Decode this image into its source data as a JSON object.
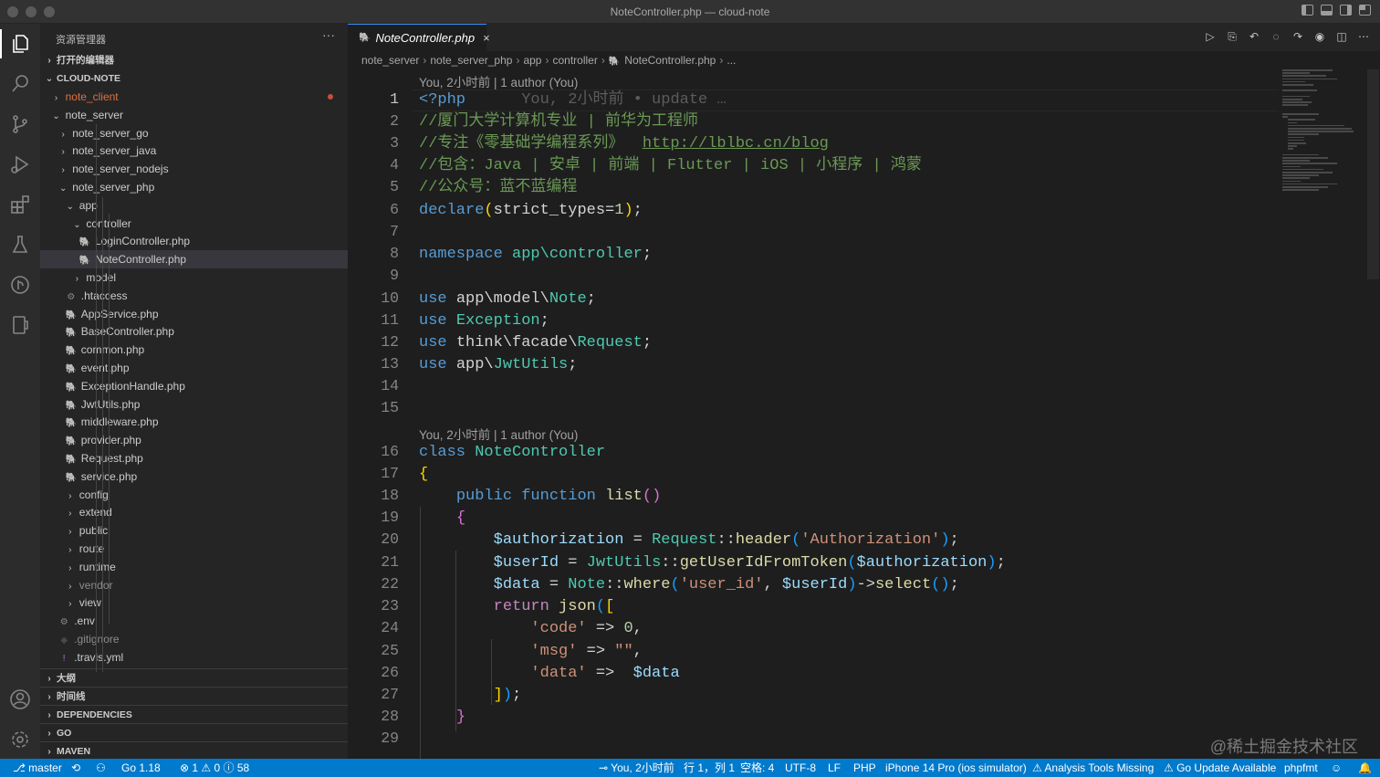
{
  "window": {
    "title": "NoteController.php — cloud-note"
  },
  "activity_bar": {
    "items": [
      "explorer",
      "search",
      "source-control",
      "run-debug",
      "extensions",
      "testing",
      "git-history",
      "remote",
      "accounts",
      "manage"
    ]
  },
  "sidebar": {
    "title": "资源管理器",
    "more": "···",
    "open_editors": "打开的编辑器",
    "workspace": "CLOUD-NOTE",
    "tree": [
      {
        "label": "note_client",
        "chev": "›",
        "status": "modified"
      },
      {
        "label": "note_server",
        "chev": "⌄"
      },
      {
        "label": "note_server_go",
        "chev": "›"
      },
      {
        "label": "note_server_java",
        "chev": "›"
      },
      {
        "label": "note_server_nodejs",
        "chev": "›"
      },
      {
        "label": "note_server_php",
        "chev": "⌄"
      },
      {
        "label": "app",
        "chev": "⌄"
      },
      {
        "label": "controller",
        "chev": "⌄"
      },
      {
        "label": "LoginController.php",
        "icon": "php"
      },
      {
        "label": "NoteController.php",
        "icon": "php"
      },
      {
        "label": "model",
        "chev": "›"
      },
      {
        "label": ".htaccess",
        "icon": "gear"
      },
      {
        "label": "AppService.php",
        "icon": "php"
      },
      {
        "label": "BaseController.php",
        "icon": "php"
      },
      {
        "label": "common.php",
        "icon": "php"
      },
      {
        "label": "event.php",
        "icon": "php"
      },
      {
        "label": "ExceptionHandle.php",
        "icon": "php"
      },
      {
        "label": "JwtUtils.php",
        "icon": "php"
      },
      {
        "label": "middleware.php",
        "icon": "php"
      },
      {
        "label": "provider.php",
        "icon": "php"
      },
      {
        "label": "Request.php",
        "icon": "php"
      },
      {
        "label": "service.php",
        "icon": "php"
      },
      {
        "label": "config",
        "chev": "›"
      },
      {
        "label": "extend",
        "chev": "›"
      },
      {
        "label": "public",
        "chev": "›"
      },
      {
        "label": "route",
        "chev": "›"
      },
      {
        "label": "runtime",
        "chev": "›"
      },
      {
        "label": "vendor",
        "chev": "›"
      },
      {
        "label": "view",
        "chev": "›"
      },
      {
        "label": ".env",
        "icon": "gear"
      },
      {
        "label": ".gitignore",
        "icon": "diamond"
      },
      {
        "label": ".travis.yml",
        "icon": "bang"
      }
    ],
    "sections": [
      "大纲",
      "时间线",
      "DEPENDENCIES",
      "GO",
      "MAVEN"
    ]
  },
  "editor": {
    "tab": {
      "label": "NoteController.php",
      "close": "×"
    },
    "breadcrumb": [
      "note_server",
      "note_server_php",
      "app",
      "controller",
      "NoteController.php",
      "..."
    ],
    "codelens_top": "You, 2小时前 | 1 author (You)",
    "codelens_class": "You, 2小时前 | 1 author (You)",
    "blame_inline": "You, 2小时前 • update …",
    "line_numbers": [
      "1",
      "2",
      "3",
      "4",
      "5",
      "6",
      "7",
      "8",
      "9",
      "10",
      "11",
      "12",
      "13",
      "14",
      "15",
      "16",
      "17",
      "18",
      "19",
      "20",
      "21",
      "22",
      "23",
      "24",
      "25",
      "26",
      "27",
      "28",
      "29"
    ]
  },
  "code": {
    "l1": "<?php",
    "l2": "//厦门大学计算机专业 | 前华为工程师",
    "l3a": "//专注《零基础学编程系列》  ",
    "l3b": "http://lblbc.cn/blog",
    "l4": "//包含：Java | 安卓 | 前端 | Flutter | iOS | 小程序 | 鸿蒙",
    "l5": "//公众号：蓝不蓝编程",
    "l6a": "declare",
    "l6b": "strict_types",
    "l6c": "1",
    "l8a": "namespace",
    "l8b": "app\\controller",
    "l10a": "use",
    "l10b": "app\\model\\",
    "l10c": "Note",
    "l11a": "use",
    "l11b": "Exception",
    "l12a": "use",
    "l12b": "think\\facade\\",
    "l12c": "Request",
    "l13a": "use",
    "l13b": "app\\",
    "l13c": "JwtUtils",
    "l16a": "class",
    "l16b": "NoteController",
    "l18a": "public",
    "l18b": "function",
    "l18c": "list",
    "l20a": "$authorization",
    "l20b": "Request",
    "l20c": "header",
    "l20d": "'Authorization'",
    "l21a": "$userId",
    "l21b": "JwtUtils",
    "l21c": "getUserIdFromToken",
    "l21d": "$authorization",
    "l22a": "$data",
    "l22b": "Note",
    "l22c": "where",
    "l22d": "'user_id'",
    "l22e": "$userId",
    "l22f": "select",
    "l23a": "return",
    "l23b": "json",
    "l24a": "'code'",
    "l24b": "0",
    "l25a": "'msg'",
    "l25b": "\"\"",
    "l26a": "'data'",
    "l26b": "$data"
  },
  "watermark": "@稀土掘金技术社区",
  "statusbar": {
    "branch": "master",
    "sync": "⟲",
    "go_version": "Go 1.18",
    "problems": "⊗ 1 ⚠ 0 ⓘ 58",
    "blame": "You, 2小时前",
    "position": "行 1，列 1",
    "spaces": "空格: 4",
    "encoding": "UTF-8",
    "eol": "LF",
    "language": "PHP",
    "device": "iPhone 14 Pro (ios simulator)",
    "analysis": "⚠ Analysis Tools Missing",
    "go_update": "⚠ Go Update Available",
    "formatter": "phpfmt"
  },
  "colors": {
    "accent": "#007acc",
    "tab_border": "#3794ff",
    "modified": "#e2703a"
  }
}
